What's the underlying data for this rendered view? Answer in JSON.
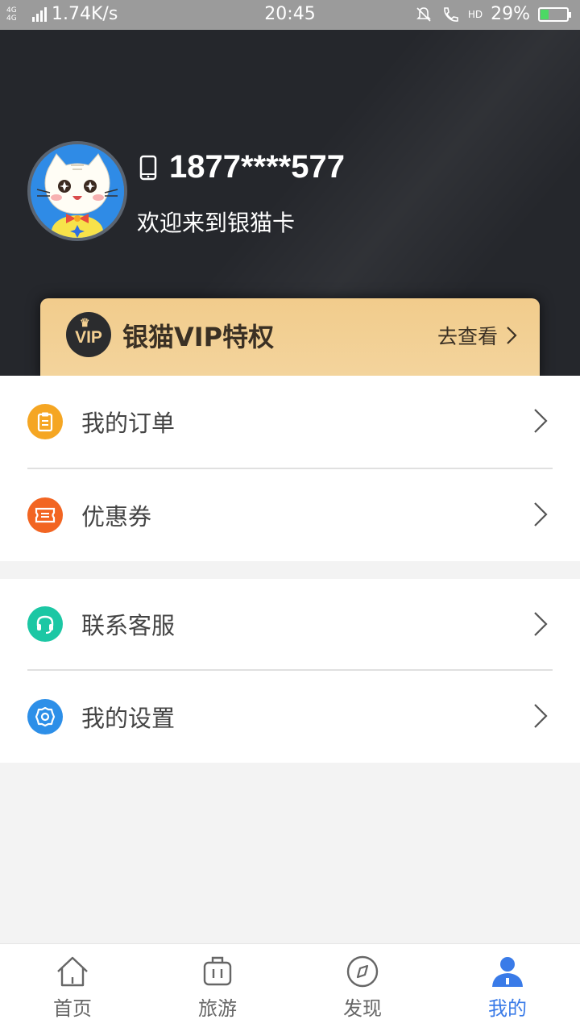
{
  "status_bar": {
    "network": "4G 4G",
    "speed": "1.74K/s",
    "time": "20:45",
    "hd": "HD",
    "battery": "29%",
    "battery_level": 0.29
  },
  "profile": {
    "phone": "1877****577",
    "welcome": "欢迎来到银猫卡"
  },
  "vip": {
    "badge": "VIP",
    "title": "银猫VIP特权",
    "action": "去查看"
  },
  "menu_group_1": [
    {
      "label": "我的订单",
      "icon": "clipboard-icon",
      "color": "#f5a623"
    },
    {
      "label": "优惠券",
      "icon": "ticket-icon",
      "color": "#f26522"
    }
  ],
  "menu_group_2": [
    {
      "label": "联系客服",
      "icon": "headset-icon",
      "color": "#1cc7a4"
    },
    {
      "label": "我的设置",
      "icon": "gear-icon",
      "color": "#2d8fe8"
    }
  ],
  "tabs": [
    {
      "label": "首页",
      "icon": "home-icon"
    },
    {
      "label": "旅游",
      "icon": "suitcase-icon"
    },
    {
      "label": "发现",
      "icon": "compass-icon"
    },
    {
      "label": "我的",
      "icon": "user-icon",
      "active": true
    }
  ],
  "colors": {
    "header_bg": "#25272c",
    "vip_gold": "#f2cc8c",
    "accent": "#3a7be8"
  }
}
